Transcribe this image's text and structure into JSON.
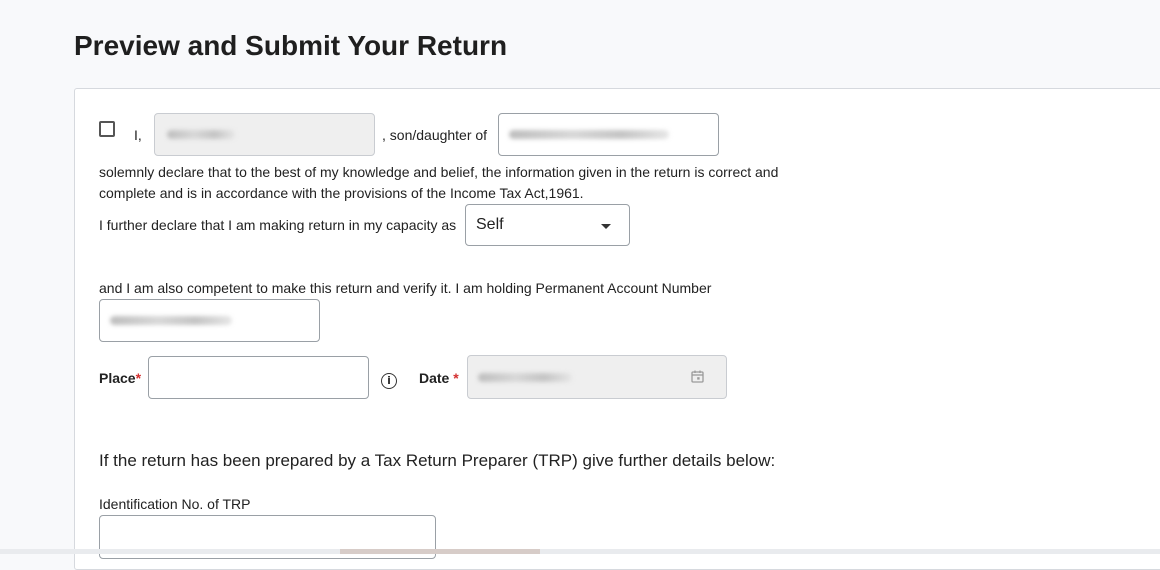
{
  "page": {
    "title": "Preview and Submit Your Return"
  },
  "declaration": {
    "i_label": "I,",
    "son_daughter_label": ", son/daughter of",
    "solemn_line1": "solemnly declare that to the best of my knowledge and belief, the information given in the return is correct and",
    "solemn_line2": "complete and is in accordance with the provisions of the Income Tax Act,1961.",
    "capacity_label": "I further declare that I am making return in my capacity as",
    "capacity_value": "Self",
    "competent_label": "and I am also competent to make this return and verify it.  I am holding Permanent Account Number"
  },
  "place": {
    "label": "Place",
    "required_mark": "*",
    "value": ""
  },
  "date": {
    "label": "Date",
    "required_mark": "*"
  },
  "trp": {
    "heading": "If the return has been prepared by a Tax Return Preparer (TRP) give further details below:",
    "id_label": "Identification No. of TRP",
    "id_value": ""
  },
  "icons": {
    "info": "info-icon",
    "calendar": "calendar-icon",
    "dropdown": "chevron-down-icon",
    "checkbox": "checkbox-unchecked"
  }
}
